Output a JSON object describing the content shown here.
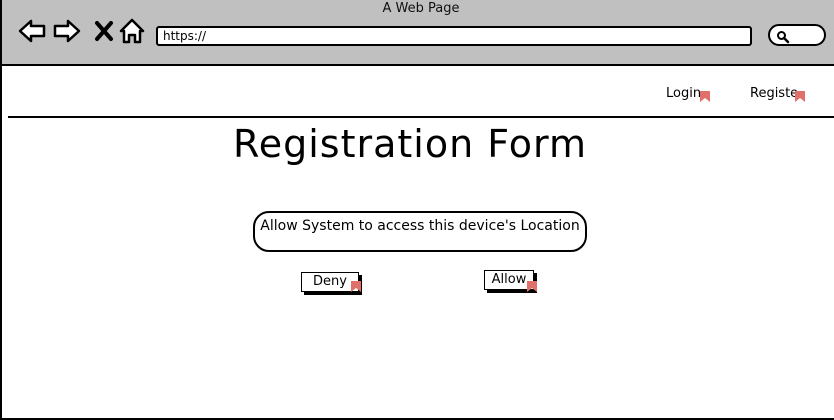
{
  "window": {
    "title": "A Web Page"
  },
  "toolbar": {
    "back_icon": "back-arrow-icon",
    "forward_icon": "forward-arrow-icon",
    "close_icon": "close-icon",
    "home_icon": "home-icon",
    "search_icon": "search-icon"
  },
  "address_bar": {
    "value": "https://"
  },
  "nav": {
    "login_label": "Login",
    "register_label": "Registe"
  },
  "main": {
    "title": "Registration Form",
    "prompt": "Allow System to access this device's Location",
    "deny_label": "Deny",
    "allow_label": "Allow"
  },
  "colors": {
    "chrome_bg": "#c0c0c0",
    "link_marker": "#e0706a"
  }
}
